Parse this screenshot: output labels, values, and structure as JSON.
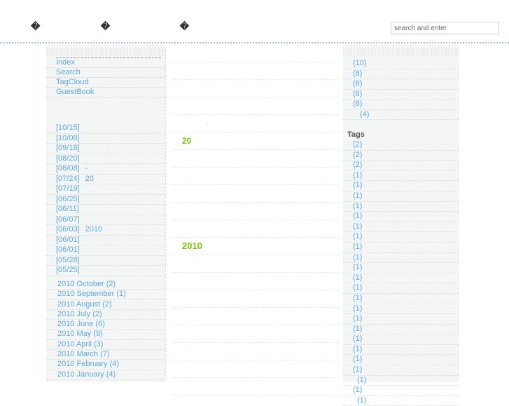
{
  "header": {
    "blog_title_part1": "�",
    "blog_title_part2": "�",
    "blog_title_part3": "�",
    "search": {
      "placeholder": "search and enter",
      "value": ""
    }
  },
  "sidebar_left": {
    "menu": [
      {
        "label": "Index"
      },
      {
        "label": "Search"
      },
      {
        "label": "TagCloud"
      },
      {
        "label": "GuestBook"
      }
    ],
    "recent_posts": [
      {
        "date": "[10/15]",
        "extra": ""
      },
      {
        "date": "[10/08]",
        "extra": ""
      },
      {
        "date": "[09/18]",
        "extra": ""
      },
      {
        "date": "[08/20]",
        "extra": ""
      },
      {
        "date": "[08/08]",
        "extra": "-"
      },
      {
        "date": "[07/24]",
        "extra": "20"
      },
      {
        "date": "[07/19]",
        "extra": ""
      },
      {
        "date": "[06/25]",
        "extra": ""
      },
      {
        "date": "[06/11]",
        "extra": ""
      },
      {
        "date": "[06/07]",
        "extra": ""
      },
      {
        "date": "[06/03]",
        "extra": "2010"
      },
      {
        "date": "[06/01]",
        "extra": ""
      },
      {
        "date": "[06/01]",
        "extra": ""
      },
      {
        "date": "[05/28]",
        "extra": ""
      },
      {
        "date": "[05/25]",
        "extra": ""
      }
    ],
    "archive": [
      {
        "label": "2010 October (2)"
      },
      {
        "label": "2010 September (1)"
      },
      {
        "label": "2010 August (2)"
      },
      {
        "label": "2010 July (2)"
      },
      {
        "label": "2010 June (6)"
      },
      {
        "label": "2010 May (9)"
      },
      {
        "label": "2010 April (3)"
      },
      {
        "label": "2010 March (7)"
      },
      {
        "label": "2010 February (4)"
      },
      {
        "label": "2010 January (4)"
      }
    ]
  },
  "content": {
    "rows": [
      {
        "text": "",
        "style": "plain"
      },
      {
        "text": "",
        "style": "plain"
      },
      {
        "text": "",
        "style": "plain"
      },
      {
        "text": "",
        "style": "plain"
      },
      {
        "text": "-",
        "style": "dash"
      },
      {
        "text": "20",
        "style": "green"
      },
      {
        "text": "",
        "style": "plain"
      },
      {
        "text": "",
        "style": "plain"
      },
      {
        "text": "",
        "style": "plain"
      },
      {
        "text": "",
        "style": "plain"
      },
      {
        "text": "",
        "style": "plain"
      },
      {
        "text": "2010",
        "style": "green-big"
      },
      {
        "text": "",
        "style": "plain"
      },
      {
        "text": "",
        "style": "plain"
      },
      {
        "text": "",
        "style": "plain"
      },
      {
        "text": "",
        "style": "plain"
      },
      {
        "text": "",
        "style": "plain"
      },
      {
        "text": "",
        "style": "plain"
      },
      {
        "text": "",
        "style": "plain"
      },
      {
        "text": "",
        "style": "plain"
      }
    ]
  },
  "sidebar_right": {
    "categories": [
      {
        "count": "(10)",
        "sub": false
      },
      {
        "count": "(8)",
        "sub": false
      },
      {
        "count": "(6)",
        "sub": false
      },
      {
        "count": "(6)",
        "sub": false
      },
      {
        "count": "(6)",
        "sub": false
      },
      {
        "count": "(4)",
        "sub": true
      }
    ],
    "tags_heading": "Tags",
    "tags": [
      {
        "count": "(2)",
        "indent": false
      },
      {
        "count": "(2)",
        "indent": false
      },
      {
        "count": "(2)",
        "indent": false
      },
      {
        "count": "(1)",
        "indent": false
      },
      {
        "count": "(1)",
        "indent": false
      },
      {
        "count": "(1)",
        "indent": false
      },
      {
        "count": "(1)",
        "indent": false
      },
      {
        "count": "(1)",
        "indent": false
      },
      {
        "count": "(1)",
        "indent": false
      },
      {
        "count": "(1)",
        "indent": false
      },
      {
        "count": "(1)",
        "indent": false
      },
      {
        "count": "(1)",
        "indent": false
      },
      {
        "count": "(1)",
        "indent": false
      },
      {
        "count": "(1)",
        "indent": false
      },
      {
        "count": "(1)",
        "indent": false
      },
      {
        "count": "(1)",
        "indent": false
      },
      {
        "count": "(1)",
        "indent": false
      },
      {
        "count": "(1)",
        "indent": false
      },
      {
        "count": "(1)",
        "indent": false
      },
      {
        "count": "(1)",
        "indent": false
      },
      {
        "count": "(1)",
        "indent": false
      },
      {
        "count": "(1)",
        "indent": false
      },
      {
        "count": "(1)",
        "indent": false
      },
      {
        "count": "(1)",
        "indent": true
      },
      {
        "count": "(1)",
        "indent": false
      },
      {
        "count": "(1)",
        "indent": true
      }
    ]
  },
  "colors": {
    "link_blue": "#5aa9e6",
    "accent_green": "#7ac70c",
    "sidebar_bg": "#f4f5f5",
    "rule_blue": "#9ec9e8"
  }
}
